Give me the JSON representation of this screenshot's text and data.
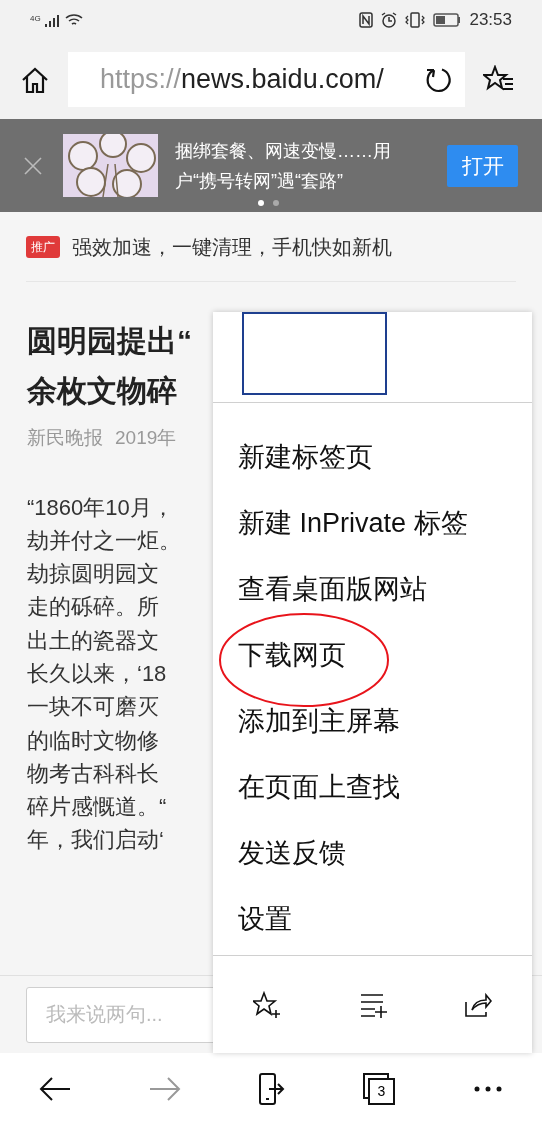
{
  "status_bar": {
    "network": "4G",
    "time": "23:53"
  },
  "address_bar": {
    "scheme": "https://",
    "host": "news.baidu.com/"
  },
  "banner": {
    "headline": "捆绑套餐、网速变慢……用户“携号转网”遇“套路”",
    "action": "打开",
    "dots": [
      {
        "selected": true
      },
      {
        "selected": false
      }
    ]
  },
  "promo": {
    "badge": "推广",
    "text": "强效加速，一键清理，手机快如新机"
  },
  "article": {
    "title_lines": [
      "圆明园提出“",
      "余枚文物碎"
    ],
    "source": "新民晚报",
    "date": "2019年",
    "body_lines": [
      "“1860年10月，",
      "劫并付之一炬。",
      "劫掠圆明园文",
      "走的砾碎。所",
      "出土的瓷器文",
      "长久以来，‘18",
      "一块不可磨灭",
      "的临时文物修",
      "物考古科科长",
      "碎片感慨道。“",
      "年，我们启动‘"
    ]
  },
  "comment": {
    "placeholder": "我来说两句..."
  },
  "menu": {
    "items": [
      {
        "label": "新建标签页",
        "highlighted": false
      },
      {
        "label": "新建 InPrivate 标签",
        "highlighted": false
      },
      {
        "label": "查看桌面版网站",
        "highlighted": false
      },
      {
        "label": "下载网页",
        "highlighted": true
      },
      {
        "label": "添加到主屏幕",
        "highlighted": false
      },
      {
        "label": "在页面上查找",
        "highlighted": false
      },
      {
        "label": "发送反馈",
        "highlighted": false
      },
      {
        "label": "设置",
        "highlighted": false
      }
    ]
  },
  "bottom_nav": {
    "forward_disabled": true,
    "tab_count": "3"
  }
}
